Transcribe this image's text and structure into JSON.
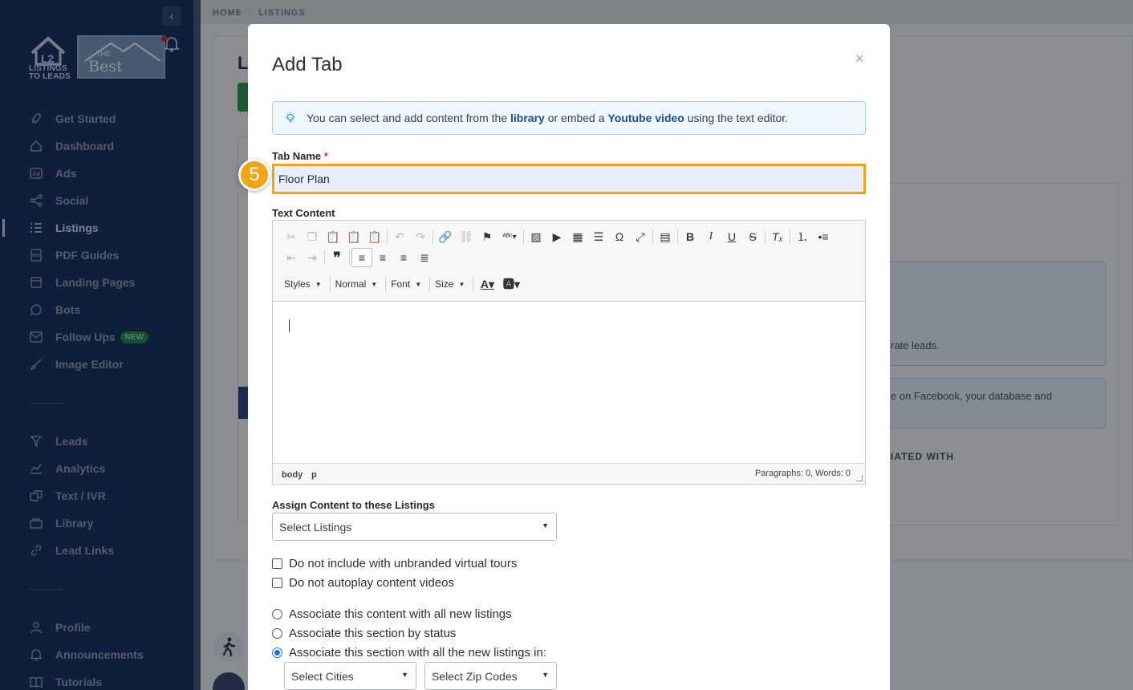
{
  "sidebar": {
    "brand": {
      "line1": "LISTINGS",
      "line2": "TO LEADS"
    },
    "partner_logo": {
      "the": "THE",
      "name": "Best Listing"
    },
    "items_top": [
      {
        "label": "Get Started",
        "icon": "rocket-icon"
      },
      {
        "label": "Dashboard",
        "icon": "home-icon"
      },
      {
        "label": "Ads",
        "icon": "ad-icon"
      },
      {
        "label": "Social",
        "icon": "share-icon"
      },
      {
        "label": "Listings",
        "icon": "list-icon",
        "active": true
      },
      {
        "label": "PDF Guides",
        "icon": "pdf-icon"
      },
      {
        "label": "Landing Pages",
        "icon": "page-icon"
      },
      {
        "label": "Bots",
        "icon": "chat-icon"
      },
      {
        "label": "Follow Ups",
        "icon": "mail-icon",
        "badge": "NEW"
      },
      {
        "label": "Image Editor",
        "icon": "brush-icon"
      }
    ],
    "items_mid": [
      {
        "label": "Leads",
        "icon": "filter-icon"
      },
      {
        "label": "Analytics",
        "icon": "chart-icon"
      },
      {
        "label": "Text / IVR",
        "icon": "sms-icon"
      },
      {
        "label": "Library",
        "icon": "folder-icon"
      },
      {
        "label": "Lead Links",
        "icon": "link-icon"
      }
    ],
    "items_bottom": [
      {
        "label": "Profile",
        "icon": "user-icon"
      },
      {
        "label": "Announcements",
        "icon": "bell-icon"
      },
      {
        "label": "Tutorials",
        "icon": "book-icon"
      }
    ]
  },
  "breadcrumb": {
    "home": "HOME",
    "current": "LISTINGS"
  },
  "background": {
    "title_initial": "L",
    "hint1": "rate leads.",
    "hint2": "e on Facebook, your database and",
    "table_header": "IATED WITH"
  },
  "modal": {
    "title": "Add Tab",
    "close": "×",
    "info": {
      "prefix": "You can select and add content from the ",
      "link1": "library",
      "middle": " or embed a ",
      "link2": "Youtube video",
      "suffix": " using the text editor."
    },
    "tab_name_label": "Tab Name",
    "required_mark": "*",
    "tab_name_value": "Floor Plan",
    "step_number": "5",
    "text_content_label": "Text Content",
    "editor": {
      "combos": [
        "Styles",
        "Normal",
        "Font",
        "Size"
      ],
      "path": [
        "body",
        "p"
      ],
      "word_count": "Paragraphs: 0, Words: 0"
    },
    "assign_label": "Assign Content to these Listings",
    "select_listings": "Select Listings",
    "checkboxes": [
      {
        "label": "Do not include with unbranded virtual tours",
        "checked": false
      },
      {
        "label": "Do not autoplay content videos",
        "checked": false
      }
    ],
    "radios": [
      {
        "label": "Associate this content with all new listings",
        "checked": false
      },
      {
        "label": "Associate this section by status",
        "checked": false
      },
      {
        "label": "Associate this section with all the new listings in:",
        "checked": true
      }
    ],
    "select_cities": "Select Cities",
    "select_zips": "Select Zip Codes"
  },
  "colors": {
    "sidebar": "#0b2456",
    "accent": "#f1a415",
    "link": "#1b4f8c",
    "active_radio": "#1a73e8"
  }
}
